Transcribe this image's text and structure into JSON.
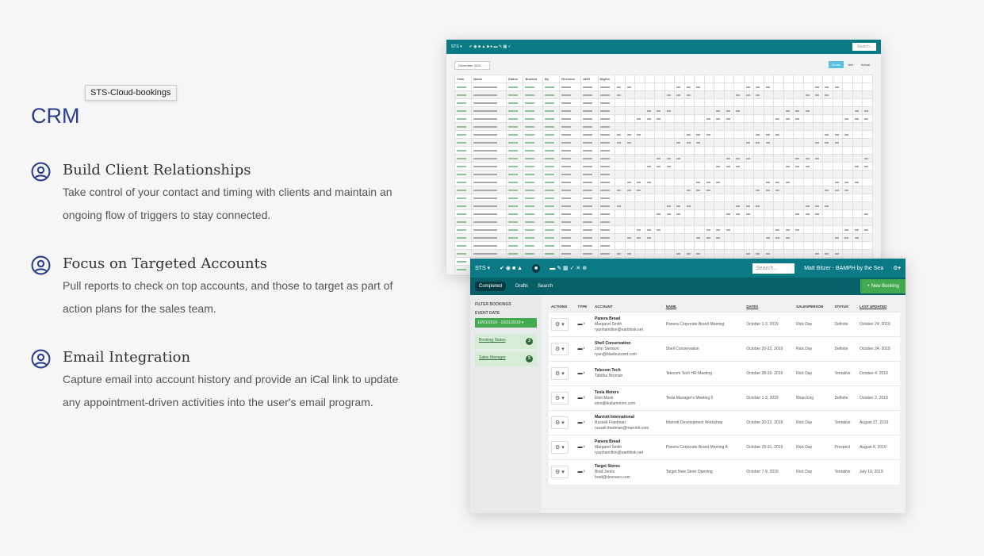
{
  "tooltip": "STS-Cloud-bookings",
  "section_title": "CRM",
  "features": [
    {
      "title": "Build Client Relationships",
      "text": "Take control of your contact and timing with clients and maintain an ongoing flow of triggers to stay connected."
    },
    {
      "title": "Focus on Targeted Accounts",
      "text": "Pull reports to check on top accounts, and those to target as part of action plans for the sales team."
    },
    {
      "title": "Email Integration",
      "text": "Capture email into account history and provide an iCal link to update any appointment-driven activities into the user's email program."
    }
  ],
  "accent": "#2c3f8f",
  "back_screen": {
    "brand": "STS ▾",
    "search": "Search...",
    "month": "December 2019",
    "toggles": [
      "Gross",
      "Net",
      "Actual"
    ],
    "columns": [
      "View",
      "Name",
      "Status",
      "Booked",
      "By",
      "Revenue",
      "ADR",
      "Nights"
    ]
  },
  "front_screen": {
    "brand": "STS ▾",
    "search_placeholder": "Search...",
    "user": "Matt Bitzer - BAMPH by the Sea",
    "tabs": [
      "Completed",
      "Drafts",
      "Search"
    ],
    "new_booking": "+ New Booking",
    "filter_title": "FILTER BOOKINGS",
    "event_date_label": "EVENT DATE",
    "date_range": "10/01/2019 - 10/31/2019 ▾",
    "filters": [
      {
        "label": "Booking Status",
        "count": "3"
      },
      {
        "label": "Sales Manager",
        "count": "5"
      }
    ],
    "columns": [
      "ACTIONS",
      "TYPE",
      "ACCOUNT",
      "NAME",
      "DATES",
      "SALESPERSON",
      "STATUS",
      "LAST UPDATED"
    ],
    "rows": [
      {
        "account": "Panera Bread",
        "contact": "Margaret Smith",
        "email": "ryanhamilton@earthlink.net",
        "name": "Panera Corporate Brand Meeting",
        "dates": "October 1-3, 2019",
        "sales": "Rick Day",
        "status": "Definite",
        "updated": "October 24, 2019"
      },
      {
        "account": "Shell Conservation",
        "contact": "John Stenson",
        "email": "ryan@bluebuzzard.com",
        "name": "Shell Conservation",
        "dates": "October 20-22, 2019",
        "sales": "Rick Day",
        "status": "Definite",
        "updated": "October 24, 2019"
      },
      {
        "account": "Telecom Tech",
        "contact": "Tabitha Norman",
        "email": "",
        "name": "Telecom Tech HR Meeting",
        "dates": "October 28-30, 2019",
        "sales": "Rick Day",
        "status": "Tentative",
        "updated": "October 4, 2019"
      },
      {
        "account": "Tesla Motors",
        "contact": "Elon Musk",
        "email": "elon@teslamotors.com",
        "name": "Tesla Manager's Meeting 6",
        "dates": "October 1-3, 2019",
        "sales": "Brian Eng",
        "status": "Definite",
        "updated": "October 2, 2019"
      },
      {
        "account": "Marriott International",
        "contact": "Russell Friedman",
        "email": "russell.friedman@marriott.com",
        "name": "Marriott Development Workshop",
        "dates": "October 20-22, 2019",
        "sales": "Rick Day",
        "status": "Tentative",
        "updated": "August 27, 2019"
      },
      {
        "account": "Panera Bread",
        "contact": "Margaret Smith",
        "email": "ryanhamilton@earthlink.net",
        "name": "Panera Corporate Brand Meeting A",
        "dates": "October 29-31, 2019",
        "sales": "Rick Day",
        "status": "Prospect",
        "updated": "August 8, 2019"
      },
      {
        "account": "Target Stores",
        "contact": "Brad Jones",
        "email": "brad@devnaco.com",
        "name": "Target New Store Opening",
        "dates": "October 7-9, 2019",
        "sales": "Rick Day",
        "status": "Tentative",
        "updated": "July 19, 2019"
      }
    ]
  }
}
